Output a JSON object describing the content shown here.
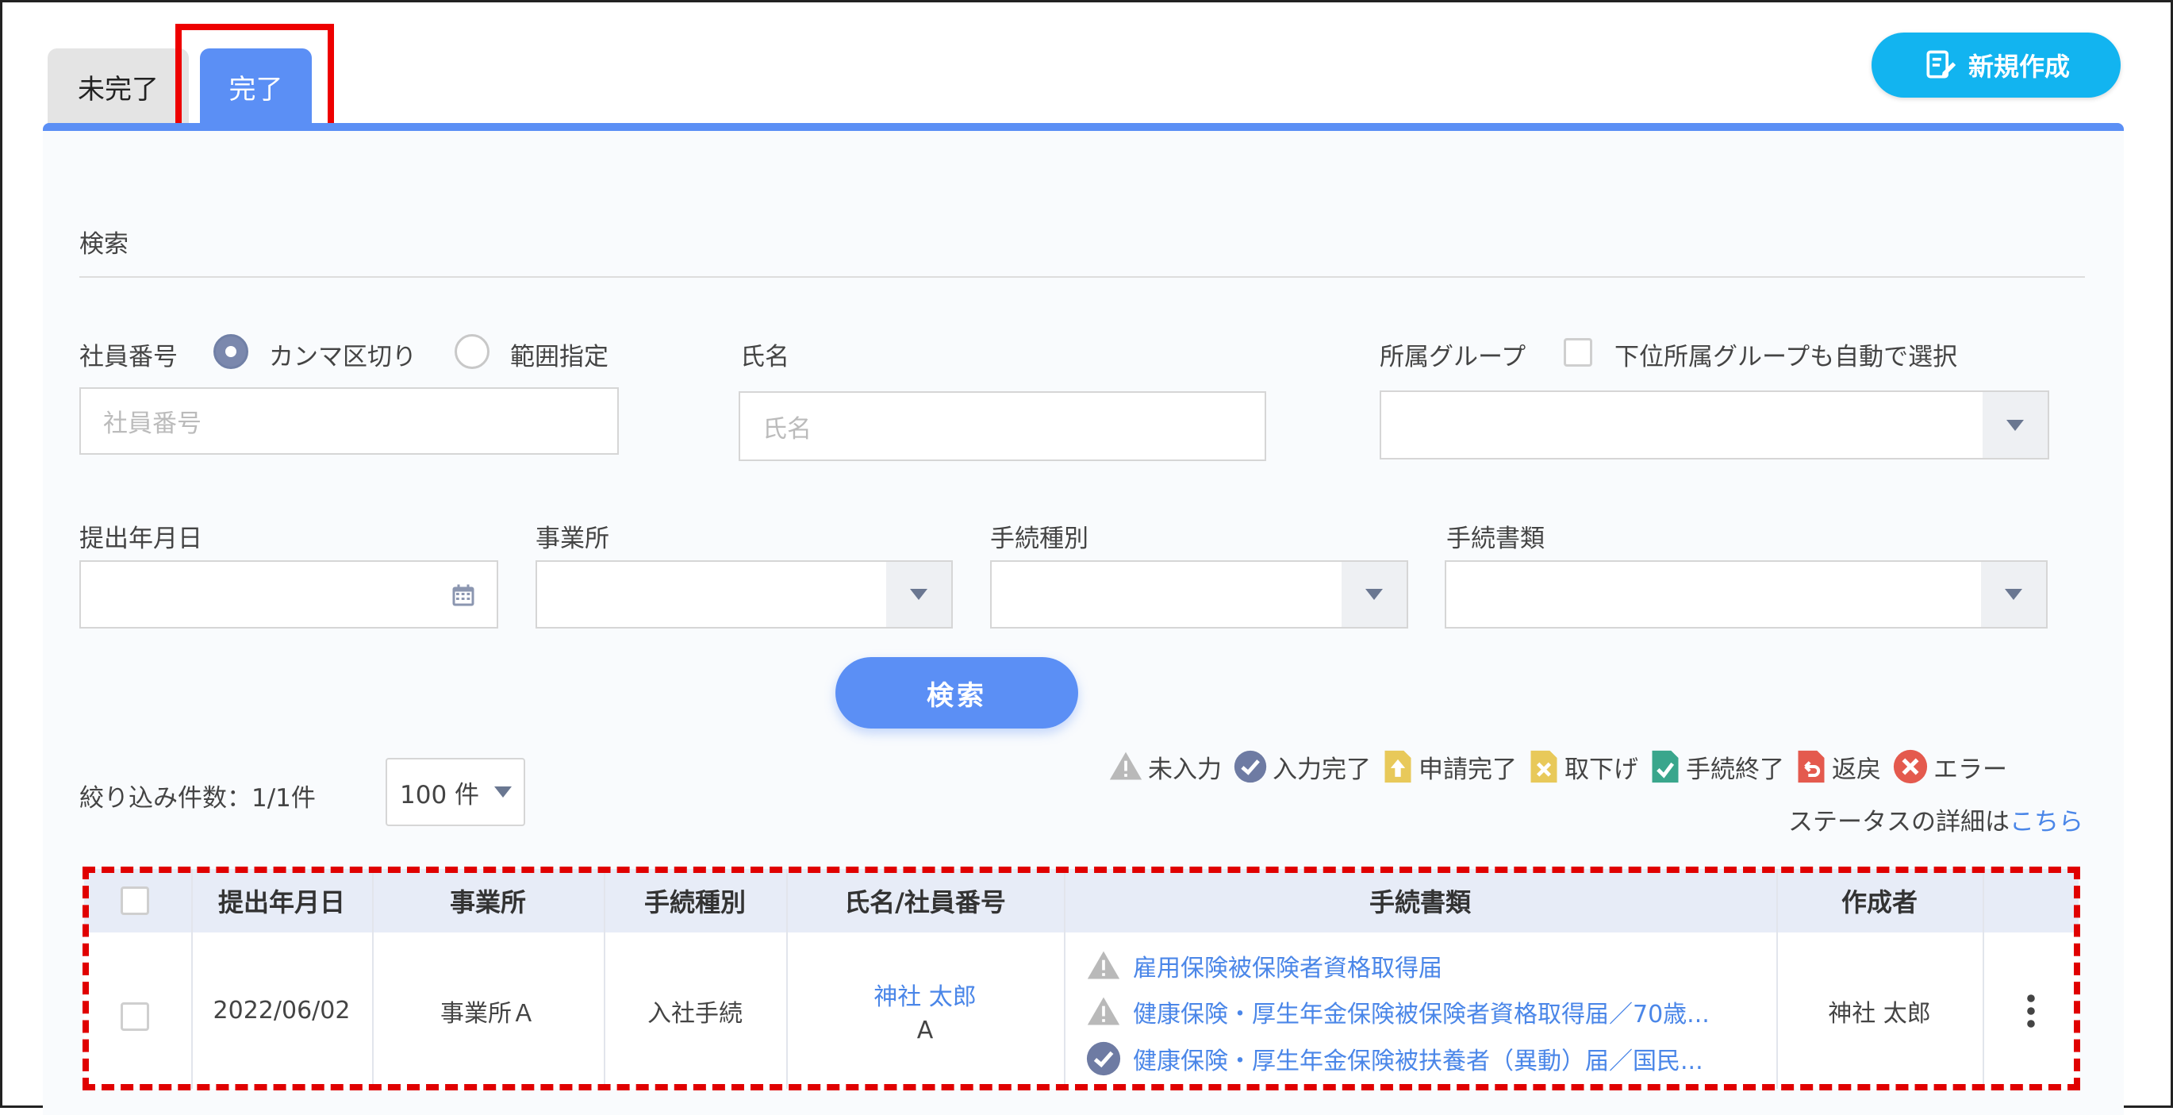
{
  "tabs": [
    {
      "label": "未完了"
    },
    {
      "label": "完了"
    }
  ],
  "new_button": {
    "label": "新規作成"
  },
  "search_section": {
    "title": "検索"
  },
  "filters": {
    "employee_no": {
      "label": "社員番号",
      "radio_comma": "カンマ区切り",
      "radio_range": "範囲指定",
      "placeholder": "社員番号"
    },
    "name": {
      "label": "氏名",
      "placeholder": "氏名"
    },
    "group": {
      "label": "所属グループ",
      "auto_select": "下位所属グループも自動で選択"
    },
    "submit_date": {
      "label": "提出年月日"
    },
    "office": {
      "label": "事業所"
    },
    "procedure_type": {
      "label": "手続種別"
    },
    "procedure_doc": {
      "label": "手続書類"
    }
  },
  "search_button": {
    "label": "検索"
  },
  "result_count": {
    "label": "絞り込み件数：1/1件"
  },
  "per_page": {
    "value": "100 件"
  },
  "legend": [
    {
      "label": "未入力",
      "icon": "warning-icon"
    },
    {
      "label": "入力完了",
      "icon": "check-circle-icon"
    },
    {
      "label": "申請完了",
      "icon": "doc-upload-icon"
    },
    {
      "label": "取下げ",
      "icon": "doc-cancel-icon"
    },
    {
      "label": "手続終了",
      "icon": "doc-check-icon"
    },
    {
      "label": "返戻",
      "icon": "doc-return-icon"
    },
    {
      "label": "エラー",
      "icon": "error-icon"
    }
  ],
  "status_detail": {
    "text": "ステータスの詳細は",
    "link": "こちら"
  },
  "table": {
    "headers": [
      "提出年月日",
      "事業所",
      "手続種別",
      "氏名/社員番号",
      "手続書類",
      "作成者"
    ],
    "rows": [
      {
        "date": "2022/06/02",
        "office": "事業所Ａ",
        "type": "入社手続",
        "name": "神社 太郎",
        "employee_no": "A",
        "docs": [
          {
            "status": "warning-icon",
            "title": "雇用保険被保険者資格取得届"
          },
          {
            "status": "warning-icon",
            "title": "健康保険・厚生年金保険被保険者資格取得届／70歳..."
          },
          {
            "status": "check-circle-icon",
            "title": "健康保険・厚生年金保険被扶養者（異動）届／国民..."
          }
        ],
        "creator": "神社 太郎"
      }
    ]
  }
}
